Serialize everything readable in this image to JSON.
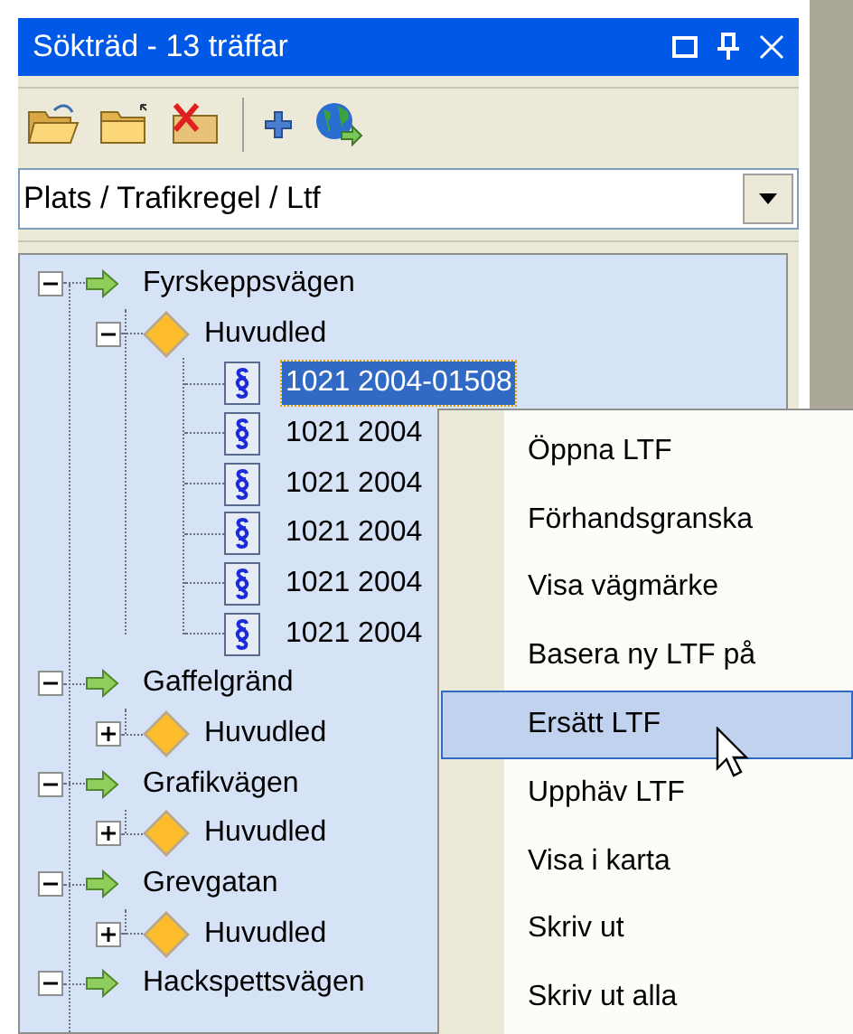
{
  "window": {
    "title": "Sökträd - 13 träffar"
  },
  "filter": {
    "value": "Plats / Trafikregel / Ltf"
  },
  "tree": [
    {
      "kind": "place",
      "label": "Fyrskeppsvägen",
      "expanded": true,
      "children": [
        {
          "kind": "route",
          "label": "Huvudled",
          "expanded": true,
          "children": [
            {
              "kind": "document",
              "label": "1021 2004-01508",
              "selected": true
            },
            {
              "kind": "document",
              "label": "1021 2004",
              "selected": false
            },
            {
              "kind": "document",
              "label": "1021 2004",
              "selected": false
            },
            {
              "kind": "document",
              "label": "1021 2004",
              "selected": false
            },
            {
              "kind": "document",
              "label": "1021 2004",
              "selected": false
            },
            {
              "kind": "document",
              "label": "1021 2004",
              "selected": false
            }
          ]
        }
      ]
    },
    {
      "kind": "place",
      "label": "Gaffelgränd",
      "expanded": true,
      "children": [
        {
          "kind": "route",
          "label": "Huvudled",
          "expanded": false
        }
      ]
    },
    {
      "kind": "place",
      "label": "Grafikvägen",
      "expanded": true,
      "children": [
        {
          "kind": "route",
          "label": "Huvudled",
          "expanded": false
        }
      ]
    },
    {
      "kind": "place",
      "label": "Grevgatan",
      "expanded": true,
      "children": [
        {
          "kind": "route",
          "label": "Huvudled",
          "expanded": false
        }
      ]
    },
    {
      "kind": "place",
      "label": "Hackspettsvägen",
      "expanded": true
    }
  ],
  "context_menu": [
    {
      "label": "Öppna LTF",
      "selected": false
    },
    {
      "label": "Förhandsgranska",
      "selected": false
    },
    {
      "label": "Visa vägmärke",
      "selected": false
    },
    {
      "label": "Basera ny LTF på",
      "selected": false
    },
    {
      "label": "Ersätt LTF",
      "selected": true
    },
    {
      "label": "Upphäv LTF",
      "selected": false
    },
    {
      "label": "Visa i karta",
      "selected": false
    },
    {
      "label": "Skriv ut",
      "selected": false
    },
    {
      "label": "Skriv ut alla",
      "selected": false
    }
  ]
}
